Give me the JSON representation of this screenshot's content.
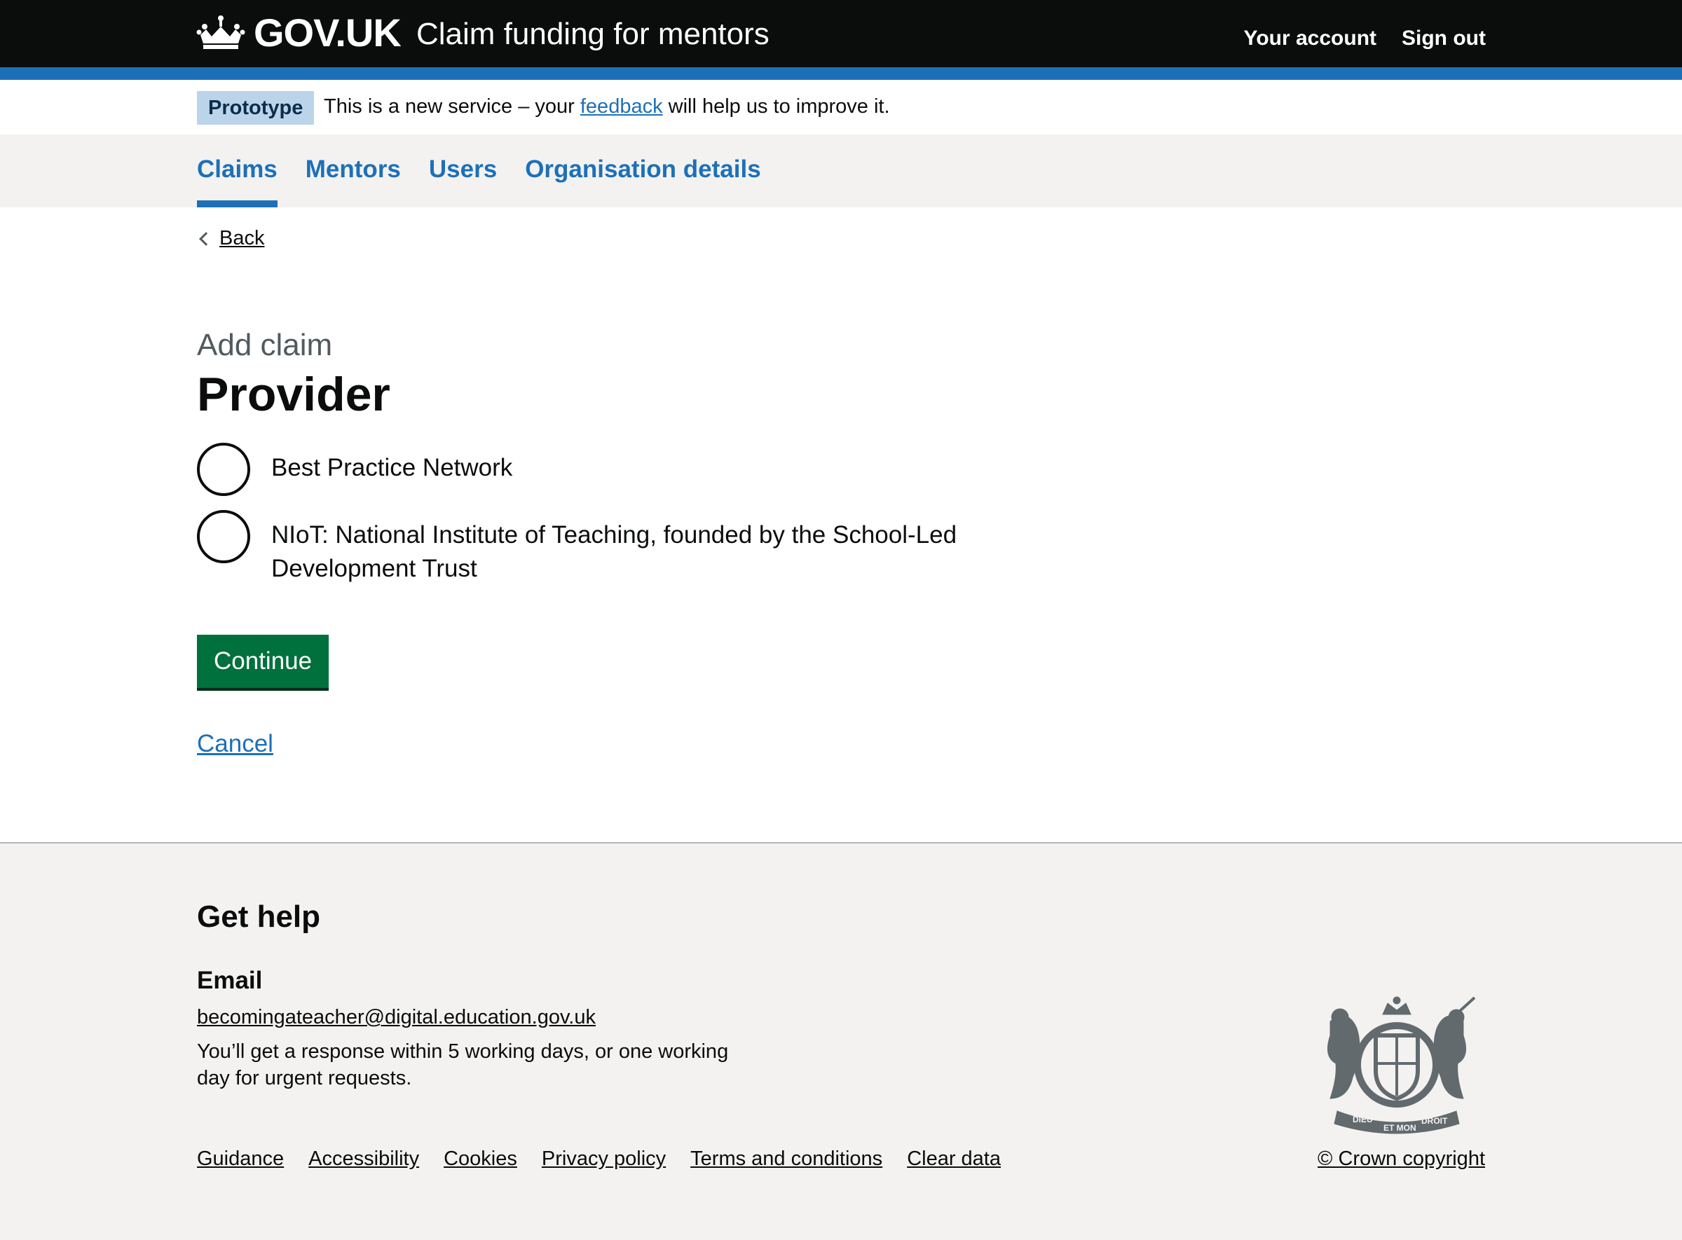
{
  "header": {
    "logo_text": "GOV.UK",
    "service_name": "Claim funding for mentors",
    "nav": [
      {
        "label": "Your account"
      },
      {
        "label": "Sign out"
      }
    ]
  },
  "phase_banner": {
    "tag": "Prototype",
    "text_before": "This is a new service – your",
    "link": "feedback",
    "text_after": "will help us to improve it."
  },
  "service_nav": {
    "items": [
      {
        "label": "Claims",
        "active": true
      },
      {
        "label": "Mentors",
        "active": false
      },
      {
        "label": "Users",
        "active": false
      },
      {
        "label": "Organisation details",
        "active": false
      }
    ]
  },
  "main": {
    "back": "Back",
    "caption": "Add claim",
    "heading": "Provider",
    "options": [
      {
        "label": "Best Practice Network",
        "selected": false
      },
      {
        "label": "NIoT: National Institute of Teaching, founded by the School-Led Development Trust",
        "selected": false
      }
    ],
    "continue": "Continue",
    "cancel": "Cancel"
  },
  "footer": {
    "help_heading": "Get help",
    "email_heading": "Email",
    "email": "becomingateacher@digital.education.gov.uk",
    "response": "You’ll get a response within 5 working days, or one working day for urgent requests.",
    "links": [
      "Guidance",
      "Accessibility",
      "Cookies",
      "Privacy policy",
      "Terms and conditions",
      "Clear data"
    ],
    "copyright": "© Crown copyright",
    "crest_text": [
      "DIEU",
      "ET MON",
      "DROIT"
    ]
  },
  "colors": {
    "header_bg": "#0b0c0c",
    "brand_blue": "#1d70b8",
    "button_green": "#00703c",
    "footer_bg": "#f3f2f1"
  }
}
